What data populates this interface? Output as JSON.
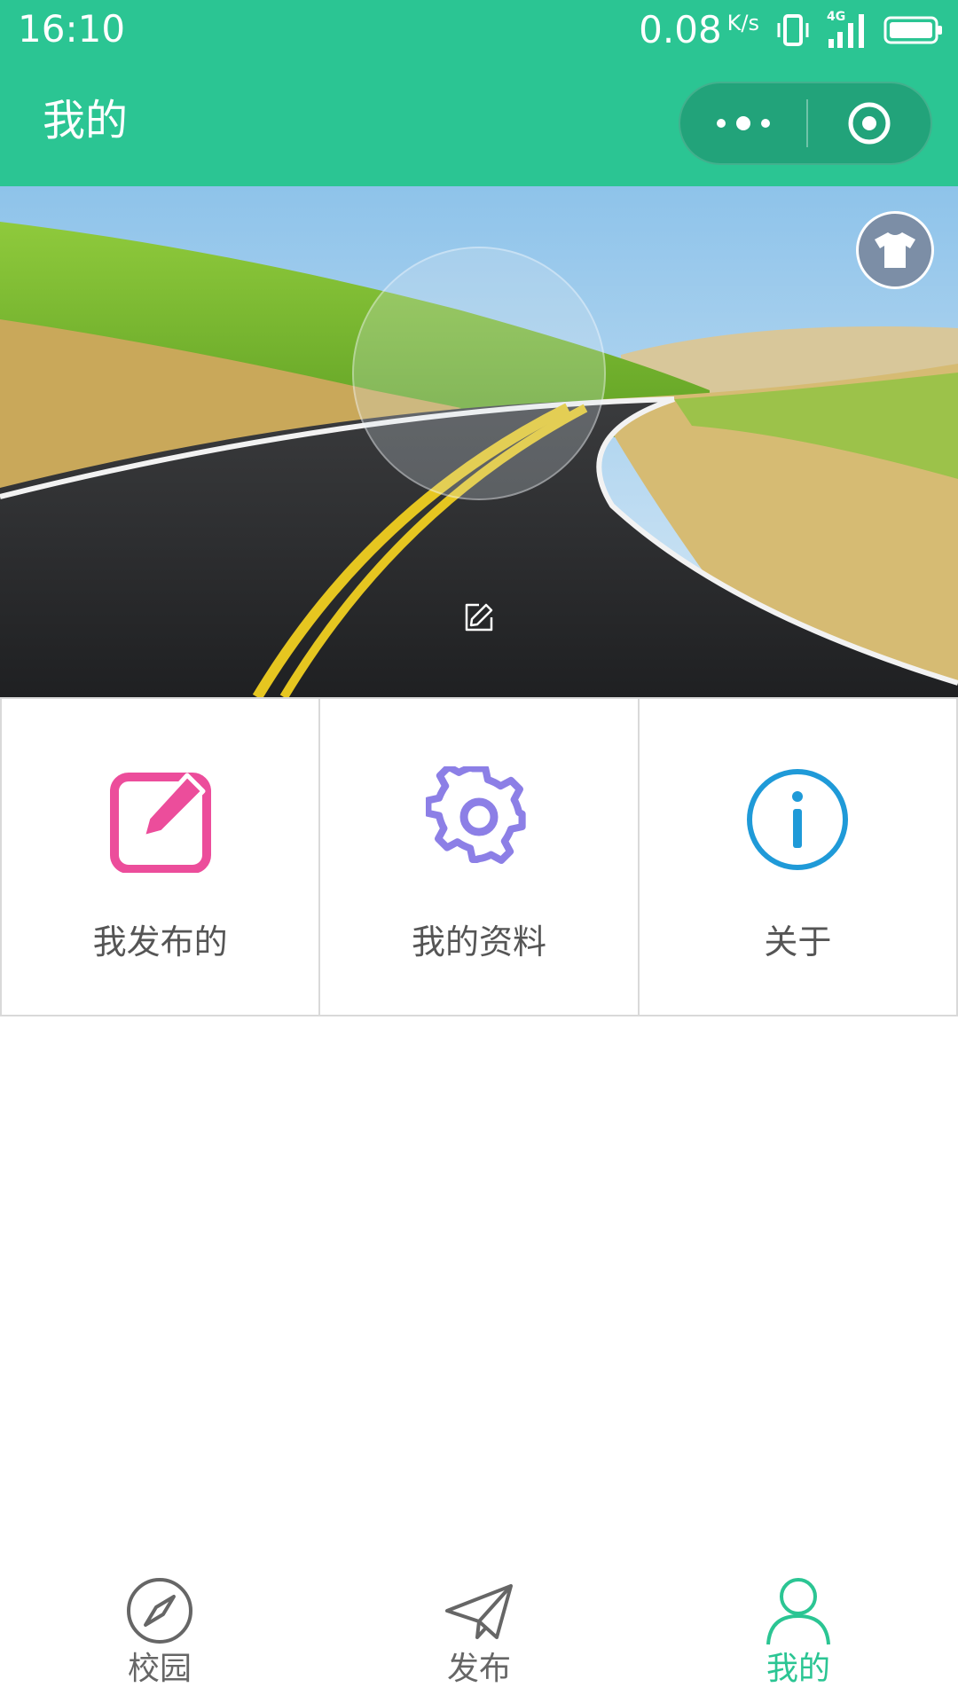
{
  "status_bar": {
    "time": "16:10",
    "net_speed": "0.08",
    "net_unit": "K/s",
    "network_type": "4G"
  },
  "nav": {
    "title": "我的"
  },
  "menu": {
    "items": [
      {
        "label": "我发布的",
        "icon": "edit-square-icon",
        "color": "#ec4d9b"
      },
      {
        "label": "我的资料",
        "icon": "gear-icon",
        "color": "#8c7fe6"
      },
      {
        "label": "关于",
        "icon": "info-icon",
        "color": "#1f9ad8"
      }
    ]
  },
  "tab_bar": {
    "items": [
      {
        "label": "校园",
        "icon": "compass-icon"
      },
      {
        "label": "发布",
        "icon": "paper-plane-icon"
      },
      {
        "label": "我的",
        "icon": "user-icon",
        "active": true
      }
    ]
  },
  "colors": {
    "primary": "#2bc593",
    "capsule": "#22a37a",
    "tab_inactive": "#666666",
    "divider": "#d9d9d9"
  }
}
